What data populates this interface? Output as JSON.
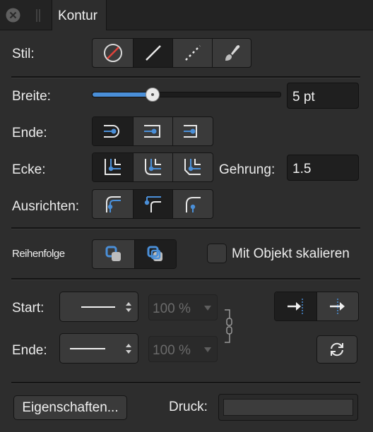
{
  "tab": {
    "title": "Kontur"
  },
  "stil": {
    "label": "Stil:",
    "options": [
      "none-icon",
      "solid-line-icon",
      "dashed-line-icon",
      "brush-icon"
    ],
    "selected": 1
  },
  "breite": {
    "label": "Breite:",
    "value": "5 pt",
    "slider_fraction": 0.33
  },
  "ende": {
    "label": "Ende:",
    "options": [
      "butt-cap-icon",
      "round-cap-icon",
      "square-cap-icon"
    ],
    "selected": 0
  },
  "ecke": {
    "label": "Ecke:",
    "options": [
      "miter-join-icon",
      "round-join-icon",
      "bevel-join-icon"
    ],
    "selected": 0,
    "gehrung_label": "Gehrung:",
    "gehrung_value": "1.5"
  },
  "ausrichten": {
    "label": "Ausrichten:",
    "options": [
      "align-inside-icon",
      "align-center-icon",
      "align-outside-icon"
    ],
    "selected": 1
  },
  "reihenfolge": {
    "label": "Reihenfolge",
    "options": [
      "stroke-behind-icon",
      "stroke-front-icon"
    ],
    "selected": 1
  },
  "skalieren": {
    "label": "Mit Objekt skalieren",
    "checked": false
  },
  "arrows": {
    "start_label": "Start:",
    "end_label": "Ende:",
    "start_scale": "100 %",
    "end_scale": "100 %",
    "position_options": [
      "arrow-beyond-end-icon",
      "arrow-at-end-icon"
    ],
    "position_selected": 0
  },
  "footer": {
    "properties_label": "Eigenschaften...",
    "pressure_label": "Druck:"
  },
  "colors": {
    "accent": "#4a8fd8",
    "panel": "#2d2d2d",
    "selected": "#1e1e1e"
  }
}
